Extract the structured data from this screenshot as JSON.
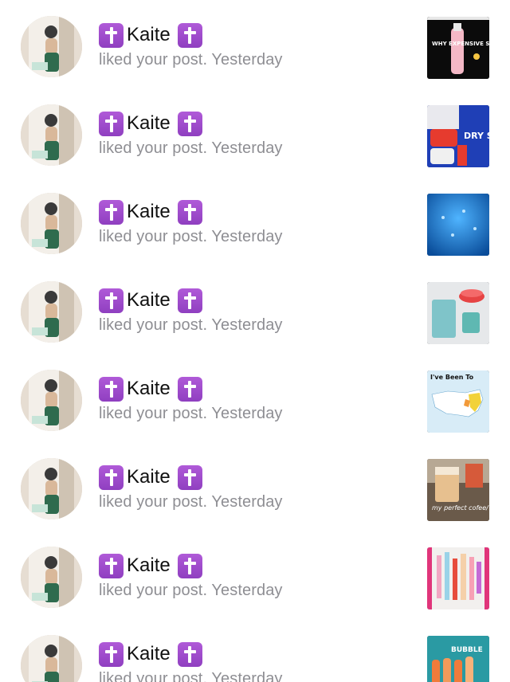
{
  "notifications": [
    {
      "user": "Kaite",
      "action": "liked your post.",
      "time": "Yesterday",
      "thumb_text": "WHY EXPENSIVE SO"
    },
    {
      "user": "Kaite",
      "action": "liked your post.",
      "time": "Yesterday",
      "thumb_text": "DRY SKIN"
    },
    {
      "user": "Kaite",
      "action": "liked your post.",
      "time": "Yesterday",
      "thumb_text": ""
    },
    {
      "user": "Kaite",
      "action": "liked your post.",
      "time": "Yesterday",
      "thumb_text": ""
    },
    {
      "user": "Kaite",
      "action": "liked your post.",
      "time": "Yesterday",
      "thumb_text": "I've Been To"
    },
    {
      "user": "Kaite",
      "action": "liked your post.",
      "time": "Yesterday",
      "thumb_text": "my perfect cofee/ morning"
    },
    {
      "user": "Kaite",
      "action": "liked your post.",
      "time": "Yesterday",
      "thumb_text": ""
    },
    {
      "user": "Kaite",
      "action": "liked your post.",
      "time": "Yesterday",
      "thumb_text": "BUBBLE"
    }
  ],
  "icons": {
    "name_prefix_icon": "latin-cross-emoji-icon",
    "name_suffix_icon": "latin-cross-emoji-icon"
  },
  "colors": {
    "cross_badge": "#9b4bcb",
    "secondary_text": "#8e8e93",
    "primary_text": "#111111"
  }
}
